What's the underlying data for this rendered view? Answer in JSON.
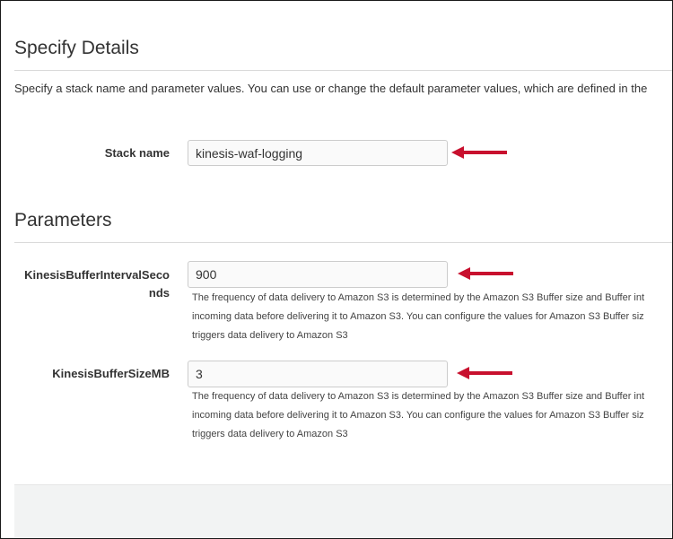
{
  "details": {
    "title": "Specify Details",
    "intro": "Specify a stack name and parameter values. You can use or change the default parameter values, which are defined in the"
  },
  "stack": {
    "label": "Stack name",
    "value": "kinesis-waf-logging"
  },
  "parameters": {
    "title": "Parameters",
    "interval": {
      "label_line1": "KinesisBufferIntervalSeco",
      "label_line2": "nds",
      "value": "900",
      "help_line1": "The frequency of data delivery to Amazon S3 is determined by the Amazon S3 Buffer size and Buffer int",
      "help_line2": "incoming data before delivering it to Amazon S3. You can configure the values for Amazon S3 Buffer siz",
      "help_line3": "triggers data delivery to Amazon S3"
    },
    "size": {
      "label": "KinesisBufferSizeMB",
      "value": "3",
      "help_line1": "The frequency of data delivery to Amazon S3 is determined by the Amazon S3 Buffer size and Buffer int",
      "help_line2": "incoming data before delivering it to Amazon S3. You can configure the values for Amazon S3 Buffer siz",
      "help_line3": "triggers data delivery to Amazon S3"
    }
  },
  "colors": {
    "arrow": "#c8102e",
    "border": "#cccccc",
    "footer": "#f2f3f3"
  },
  "icons": {
    "annotation": "left-arrow-icon"
  }
}
